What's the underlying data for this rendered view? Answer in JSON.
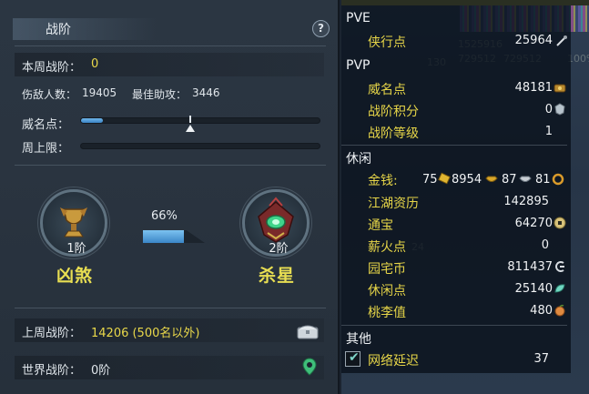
{
  "left_panel": {
    "title": "战阶",
    "help_label": "?",
    "weekly_rank_label": "本周战阶：",
    "weekly_rank_value": "0",
    "enemies_label": "伤敌人数：",
    "enemies_value": "19405",
    "best_assist_label": "最佳助攻：",
    "best_assist_value": "3446",
    "prestige_label": "威名点：",
    "prestige_fill": 0.09,
    "prestige_marker": 0.46,
    "weekly_cap_label": "周上限：",
    "weekly_cap_fill": 0.0,
    "current_rank": {
      "level": "1阶",
      "name": "凶煞"
    },
    "next_rank": {
      "level": "2阶",
      "name": "杀星"
    },
    "progress_percent_text": "66%",
    "progress_fraction": 0.66,
    "last_week_label": "上周战阶：",
    "last_week_value": "14206 (500名以外)",
    "world_rank_label": "世界战阶：",
    "world_rank_value": "0阶"
  },
  "right_panel": {
    "sections": {
      "pve": "PVE",
      "pvp": "PVP",
      "leisure": "休闲",
      "other": "其他"
    },
    "pve_items": [
      {
        "label": "侠行点",
        "value": "25964",
        "icon": "scroll-icon"
      }
    ],
    "pvp_items": [
      {
        "label": "威名点",
        "value": "48181",
        "icon": "badge-icon"
      },
      {
        "label": "战阶积分",
        "value": "0",
        "icon": "crest-icon"
      },
      {
        "label": "战阶等级",
        "value": "1",
        "icon": ""
      }
    ],
    "money": {
      "label": "金钱:",
      "gold_ingot": "75",
      "gold": "8954",
      "silver": "87",
      "copper": "81"
    },
    "leisure_items": [
      {
        "label": "江湖资历",
        "value": "142895",
        "icon": ""
      },
      {
        "label": "通宝",
        "value": "64270",
        "icon": "coin-icon"
      },
      {
        "label": "薪火点",
        "value": "0",
        "icon": ""
      },
      {
        "label": "园宅币",
        "value": "811437",
        "icon": "house-coin-icon"
      },
      {
        "label": "休闲点",
        "value": "25140",
        "icon": "leaf-icon"
      },
      {
        "label": "桃李值",
        "value": "480",
        "icon": "peach-icon"
      }
    ],
    "other_items": [
      {
        "label": "网络延迟",
        "value": "37",
        "checked": true
      }
    ],
    "background_numbers": [
      "1525916",
      "1751",
      "729512",
      "729512",
      "130",
      "100%",
      "24",
      "5"
    ]
  },
  "colors": {
    "accent_yellow": "#e9d84a",
    "progress_blue": "#3b86c7",
    "panel_bg": "#2a3440"
  }
}
